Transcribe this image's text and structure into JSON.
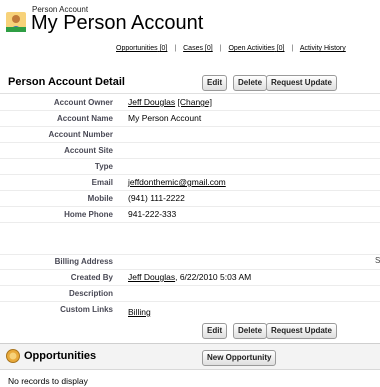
{
  "header": {
    "breadcrumb": "Person Account",
    "title": "My Person Account"
  },
  "related_links": [
    {
      "label": "Opportunities",
      "count": "[0]"
    },
    {
      "label": "Cases",
      "count": "[0]"
    },
    {
      "label": "Open Activities",
      "count": "[0]"
    },
    {
      "label": "Activity History",
      "count": ""
    }
  ],
  "detail": {
    "section_title": "Person Account Detail",
    "buttons": {
      "edit": "Edit",
      "delete": "Delete",
      "request_update": "Request Update"
    },
    "fields": {
      "account_owner": {
        "label": "Account Owner",
        "value": "Jeff Douglas",
        "extra": "[Change]"
      },
      "account_name": {
        "label": "Account Name",
        "value": "My Person Account"
      },
      "account_number": {
        "label": "Account Number",
        "value": ""
      },
      "account_site": {
        "label": "Account Site",
        "value": ""
      },
      "type": {
        "label": "Type",
        "value": ""
      },
      "email": {
        "label": "Email",
        "value": "jeffdonthemic@gmail.com"
      },
      "mobile": {
        "label": "Mobile",
        "value": "(941) 111-2222"
      },
      "home_phone": {
        "label": "Home Phone",
        "value": "941-222-333"
      },
      "billing_address": {
        "label": "Billing Address",
        "value": "",
        "edge": "S"
      },
      "created_by": {
        "label": "Created By",
        "value": "Jeff Douglas",
        "extra": ", 6/22/2010 5:03 AM"
      },
      "description": {
        "label": "Description",
        "value": ""
      },
      "custom_links": {
        "label": "Custom Links",
        "value": "Billing"
      }
    }
  },
  "opportunities": {
    "title": "Opportunities",
    "new_button": "New Opportunity",
    "empty_text": "No records to display"
  }
}
